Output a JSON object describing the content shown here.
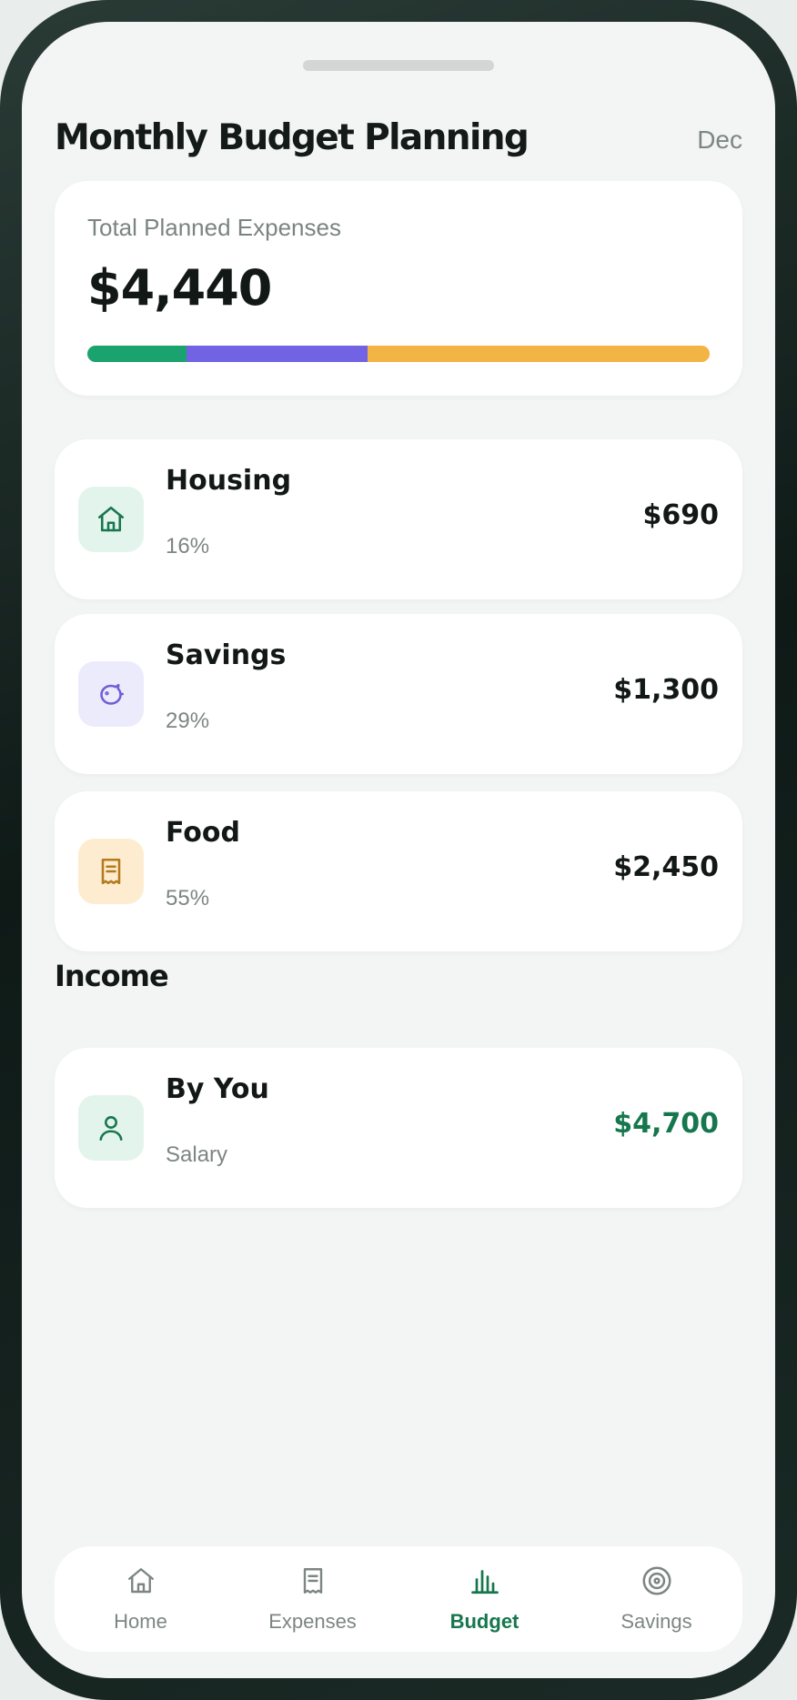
{
  "header": {
    "title": "Monthly Budget Planning",
    "month": "Dec"
  },
  "summary": {
    "label": "Total Planned Expenses",
    "amount": "$4,440",
    "segments": [
      {
        "name": "Housing",
        "percent": 16,
        "color": "#1aa36e"
      },
      {
        "name": "Savings",
        "percent": 29,
        "color": "#7163e3"
      },
      {
        "name": "Food",
        "percent": 55,
        "color": "#f2b444"
      }
    ]
  },
  "expenses": [
    {
      "title": "Housing",
      "sub": "16%",
      "amount": "$690",
      "icon": "home-icon",
      "icon_bg": "#e3f4ec",
      "icon_color": "#16774e"
    },
    {
      "title": "Savings",
      "sub": "29%",
      "amount": "$1,300",
      "icon": "piggy-bank-icon",
      "icon_bg": "#ecebfb",
      "icon_color": "#6f5fd6"
    },
    {
      "title": "Food",
      "sub": "55%",
      "amount": "$2,450",
      "icon": "receipt-icon",
      "icon_bg": "#fdecd0",
      "icon_color": "#b57a1c"
    }
  ],
  "income": {
    "section_title": "Income",
    "items": [
      {
        "title": "By You",
        "sub": "Salary",
        "amount": "$4,700",
        "amount_color": "#16774e",
        "icon": "user-icon",
        "icon_bg": "#e3f4ec",
        "icon_color": "#16774e"
      }
    ]
  },
  "nav": {
    "items": [
      {
        "label": "Home",
        "icon": "home-icon"
      },
      {
        "label": "Expenses",
        "icon": "receipt-icon"
      },
      {
        "label": "Budget",
        "icon": "bar-chart-icon",
        "active": true
      },
      {
        "label": "Savings",
        "icon": "target-icon"
      }
    ]
  }
}
